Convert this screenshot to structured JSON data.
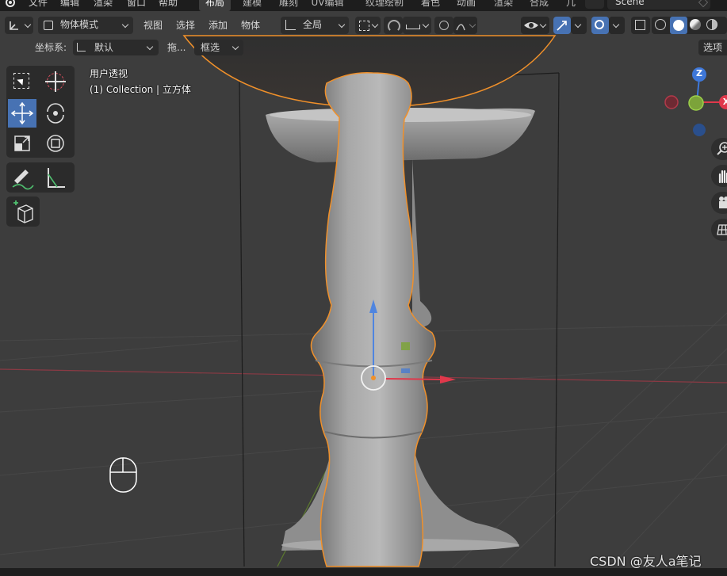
{
  "topbar": {
    "menus": [
      "文件",
      "编辑",
      "渲染",
      "窗口",
      "帮助"
    ],
    "workspaces": [
      "布局",
      "建模",
      "雕刻",
      "UV编辑",
      "纹理绘制",
      "着色",
      "动画",
      "渲染",
      "合成",
      "几"
    ],
    "active_workspace": "布局",
    "scene_name": "Scene"
  },
  "header": {
    "mode": "物体模式",
    "menus": [
      "视图",
      "选择",
      "添加",
      "物体"
    ],
    "transform_orientation": "全局"
  },
  "row2": {
    "coord_label": "坐标系:",
    "coord_value": "默认",
    "drag_label": "拖...",
    "drag_value": "框选",
    "options_label": "选项"
  },
  "viewport": {
    "view_name": "用户透视",
    "collection_info": "(1) Collection | 立方体"
  },
  "gizmo": {
    "x_label": "X",
    "z_label": "Z"
  },
  "colors": {
    "accent_blue": "#4772b3",
    "selection_orange": "#f0902a",
    "axis_red": "#e0384b",
    "axis_green": "#7ca33a",
    "axis_blue": "#3e77d8"
  },
  "watermark": "CSDN @友人a笔记"
}
